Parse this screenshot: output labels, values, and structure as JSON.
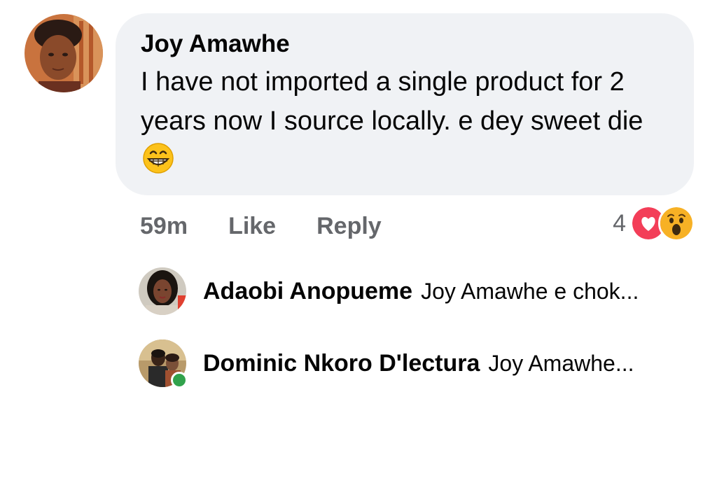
{
  "comment": {
    "author": "Joy Amawhe",
    "text": "I have not imported a single product for 2 years now I source locally. e dey sweet die",
    "time": "59m",
    "like_label": "Like",
    "reply_label": "Reply",
    "reaction_count": "4",
    "reactions": [
      "love-icon",
      "wow-icon"
    ],
    "emoji": "grinning-face-emoji"
  },
  "replies": [
    {
      "name": "Adaobi Anopueme",
      "snippet": "Joy Amawhe e chok...",
      "online": false
    },
    {
      "name": "Dominic Nkoro D'lectura",
      "snippet": "Joy Amawhe...",
      "online": true
    }
  ],
  "colors": {
    "bubble_bg": "#f0f2f5",
    "meta_text": "#65676b",
    "love": "#f33e58",
    "wow": "#f7b125",
    "online": "#31a24c"
  }
}
